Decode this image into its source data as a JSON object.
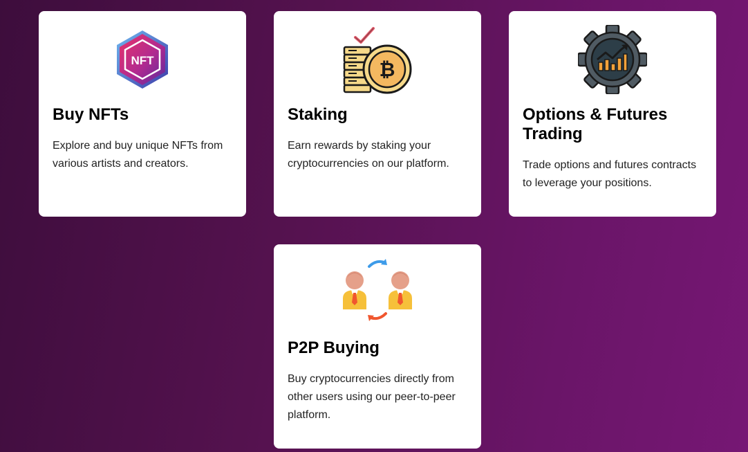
{
  "colors": {
    "background_start": "#3d0d3c",
    "background_end": "#761774",
    "card_background": "#ffffff"
  },
  "cards": [
    {
      "icon": "nft-hexagon-icon",
      "title": "Buy NFTs",
      "description": "Explore and buy unique NFTs from various artists and creators.",
      "icon_text": "NFT"
    },
    {
      "icon": "bitcoin-coins-staking-icon",
      "title": "Staking",
      "description": "Earn rewards by staking your cryptocurrencies on our platform."
    },
    {
      "icon": "gear-chart-trading-icon",
      "title": "Options & Futures Trading",
      "description": "Trade options and futures contracts to leverage your positions."
    },
    {
      "icon": "p2p-exchange-users-icon",
      "title": "P2P Buying",
      "description": "Buy cryptocurrencies directly from other users using our peer-to-peer platform."
    }
  ]
}
